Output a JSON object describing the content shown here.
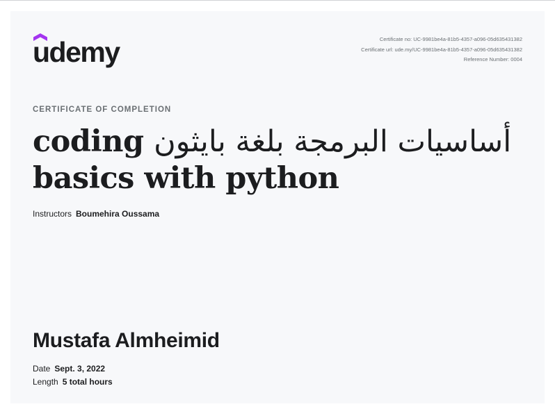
{
  "logo": {
    "text": "ûdemy",
    "brand_color": "#a435f0"
  },
  "meta": {
    "certificate_no": "Certificate no: UC-9981be4a-81b5-4357-a096-05d635431382",
    "certificate_url": "Certificate url: ude.my/UC-9981be4a-81b5-4357-a096-05d635431382",
    "reference_number": "Reference Number: 0004"
  },
  "label_completion": "CERTIFICATE OF COMPLETION",
  "course": {
    "title_arabic": "أساسيات البرمجة بلغة بايثون",
    "title_latin_1": "coding",
    "title_latin_2": "basics with python"
  },
  "instructors": {
    "label": "Instructors",
    "name": "Boumehira Oussama"
  },
  "student_name": "Mustafa Almheimid",
  "date": {
    "label": "Date",
    "value": "Sept. 3, 2022"
  },
  "length": {
    "label": "Length",
    "value": "5 total hours"
  }
}
